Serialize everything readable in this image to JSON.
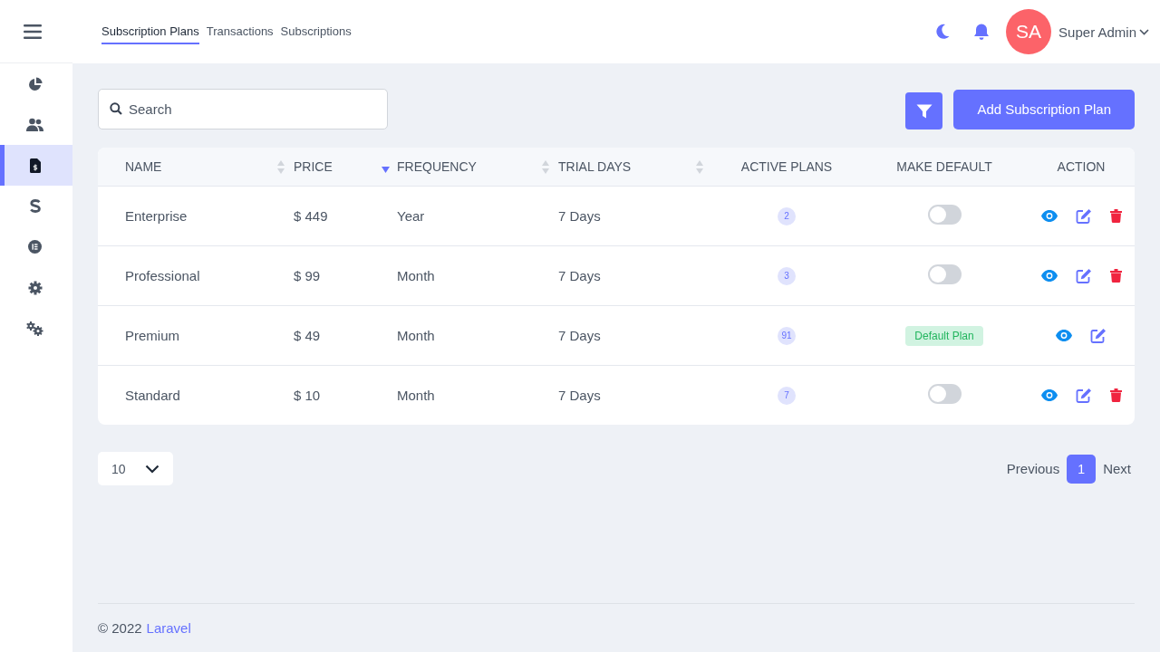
{
  "nav_tabs": [
    {
      "label": "Subscription Plans",
      "selected": true
    },
    {
      "label": "Transactions",
      "selected": false
    },
    {
      "label": "Subscriptions",
      "selected": false
    }
  ],
  "user": {
    "initials": "SA",
    "name": "Super Admin"
  },
  "sidebar": {
    "items": [
      {
        "kind": "chart",
        "selected": false
      },
      {
        "kind": "users",
        "selected": false
      },
      {
        "kind": "invoice",
        "selected": true
      },
      {
        "kind": "dollar",
        "selected": false
      },
      {
        "kind": "list",
        "selected": false
      },
      {
        "kind": "gear",
        "selected": false
      },
      {
        "kind": "gears",
        "selected": false
      }
    ]
  },
  "search": {
    "placeholder": "Search"
  },
  "add_button": "Add Subscription Plan",
  "table": {
    "columns": [
      {
        "label": "NAME",
        "sortable": true,
        "sorted_desc": false
      },
      {
        "label": "PRICE",
        "sortable": true,
        "sorted_desc": true
      },
      {
        "label": "FREQUENCY",
        "sortable": true,
        "sorted_desc": false
      },
      {
        "label": "TRIAL DAYS",
        "sortable": true,
        "sorted_desc": false
      },
      {
        "label": "ACTIVE PLANS",
        "sortable": false,
        "sorted_desc": false
      },
      {
        "label": "MAKE DEFAULT",
        "sortable": false,
        "sorted_desc": false
      },
      {
        "label": "ACTION",
        "sortable": false,
        "sorted_desc": false
      }
    ],
    "rows": [
      {
        "name": "Enterprise",
        "price": "$ 449",
        "frequency": "Year",
        "trial_days": "7 Days",
        "active_plans": "2",
        "make_default": {
          "kind": "toggle",
          "on": false
        },
        "deletable": true
      },
      {
        "name": "Professional",
        "price": "$ 99",
        "frequency": "Month",
        "trial_days": "7 Days",
        "active_plans": "3",
        "make_default": {
          "kind": "toggle",
          "on": false
        },
        "deletable": true
      },
      {
        "name": "Premium",
        "price": "$ 49",
        "frequency": "Month",
        "trial_days": "7 Days",
        "active_plans": "91",
        "make_default": {
          "kind": "badge",
          "label": "Default Plan"
        },
        "deletable": false
      },
      {
        "name": "Standard",
        "price": "$ 10",
        "frequency": "Month",
        "trial_days": "7 Days",
        "active_plans": "7",
        "make_default": {
          "kind": "toggle",
          "on": false
        },
        "deletable": true
      }
    ]
  },
  "page_size": "10",
  "pagination": {
    "previous": "Previous",
    "pages": [
      {
        "label": "1",
        "selected": true
      }
    ],
    "next": "Next"
  },
  "footer": {
    "copyright": "© 2022",
    "link": "Laravel"
  }
}
